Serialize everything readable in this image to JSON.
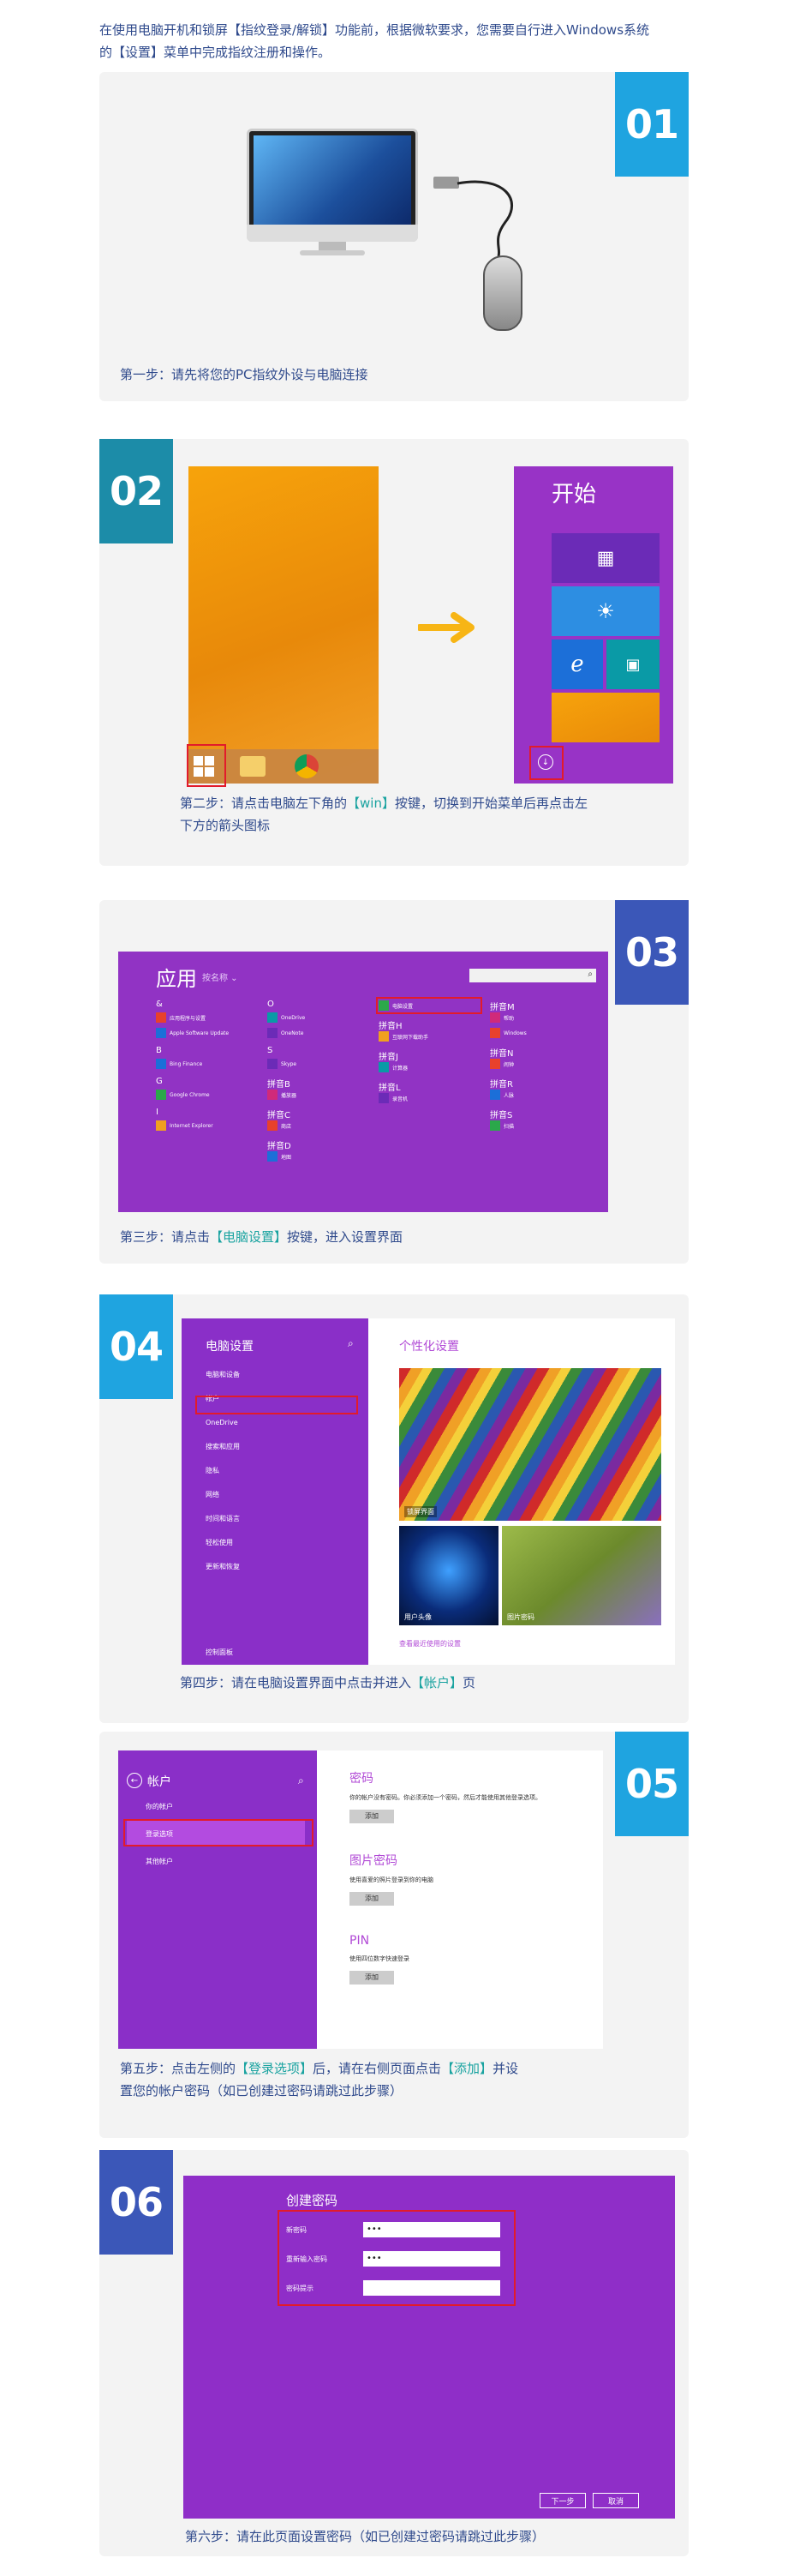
{
  "intro": {
    "line1": "在使用电脑开机和锁屏【指纹登录/解锁】功能前，根据微软要求，您需要自行进入Windows系统",
    "line2": "的【设置】菜单中完成指纹注册和操作。"
  },
  "steps": [
    {
      "badge": "01",
      "caption": "第一步：请先将您的PC指纹外设与电脑连接"
    },
    {
      "badge": "02",
      "caption_pre": "第二步：请点击电脑左下角的",
      "caption_hl": "【win】",
      "caption_post1": "按键，切换到开始菜单后再点击左",
      "caption_post2": "下方的箭头图标"
    },
    {
      "badge": "03",
      "caption_pre": "第三步：请点击",
      "caption_hl": "【电脑设置】",
      "caption_post": "按键，进入设置界面"
    },
    {
      "badge": "04",
      "caption_pre": "第四步：请在电脑设置界面中点击并进入",
      "caption_hl": "【帐户】",
      "caption_post": "页"
    },
    {
      "badge": "05",
      "caption_pre": "第五步：点击左侧的",
      "caption_hl1": "【登录选项】",
      "caption_mid": "后，请在右侧页面点击",
      "caption_hl2": "【添加】",
      "caption_post1": "并设",
      "caption_post2": "置您的帐户密码（如已创建过密码请跳过此步骤）"
    },
    {
      "badge": "06",
      "caption": "第六步：请在此页面设置密码（如已创建过密码请跳过此步骤）"
    }
  ],
  "start_screen": {
    "title": "开始",
    "tiles": [
      "日历",
      "天气",
      "Internet Explorer",
      "照片"
    ]
  },
  "apps_screen": {
    "title": "应用",
    "sort": "按名称 ⌄",
    "groups": [
      {
        "h": "&",
        "items": [
          "应用程序与设置",
          "Apple Software Update"
        ]
      },
      {
        "h": "B",
        "items": [
          "Bing Finance"
        ]
      },
      {
        "h": "G",
        "items": [
          "Google Chrome"
        ]
      },
      {
        "h": "I",
        "items": [
          "Internet Explorer"
        ]
      },
      {
        "h": "O",
        "items": [
          "OneDrive",
          "OneNote"
        ]
      },
      {
        "h": "S",
        "items": [
          "Skype"
        ]
      },
      {
        "h": "拼音B",
        "items": [
          "播放器"
        ]
      },
      {
        "h": "拼音C",
        "items": [
          "商店"
        ]
      },
      {
        "h": "拼音D",
        "items": [
          "地图"
        ]
      },
      {
        "h": "",
        "items": [
          "电脑设置"
        ]
      },
      {
        "h": "拼音H",
        "items": [
          "互联网下载助手"
        ]
      },
      {
        "h": "拼音J",
        "items": [
          "计算器"
        ]
      },
      {
        "h": "拼音L",
        "items": [
          "录音机"
        ]
      },
      {
        "h": "拼音M",
        "items": [
          "帮助",
          "Windows"
        ]
      },
      {
        "h": "拼音N",
        "items": [
          "闹钟"
        ]
      },
      {
        "h": "拼音R",
        "items": [
          "人脉"
        ]
      },
      {
        "h": "拼音S",
        "items": [
          "扫描"
        ]
      }
    ],
    "highlight_item": "电脑设置"
  },
  "pc_settings": {
    "title": "电脑设置",
    "menu": [
      "电脑和设备",
      "帐户",
      "OneDrive",
      "搜索和应用",
      "隐私",
      "网络",
      "时间和语言",
      "轻松使用",
      "更新和恢复"
    ],
    "footer": "控制面板",
    "right_title": "个性化设置",
    "img_labels": [
      "锁屏界面",
      "用户头像",
      "图片密码"
    ],
    "link": "查看最近使用的设置"
  },
  "account": {
    "title": "帐户",
    "menu": [
      "你的帐户",
      "登录选项",
      "其他帐户"
    ],
    "sections": [
      {
        "title": "密码",
        "desc": "你的帐户没有密码。你必须添加一个密码，然后才能使用其他登录选项。",
        "button": "添加"
      },
      {
        "title": "图片密码",
        "desc": "使用喜爱的照片登录到你的电脑",
        "button": "添加"
      },
      {
        "title": "PIN",
        "desc": "使用四位数字快速登录",
        "button": "添加"
      }
    ]
  },
  "create_password": {
    "title": "创建密码",
    "fields": [
      {
        "label": "新密码",
        "value": "•••"
      },
      {
        "label": "重新输入密码",
        "value": "•••"
      },
      {
        "label": "密码提示",
        "value": ""
      }
    ],
    "next": "下一步",
    "cancel": "取消"
  },
  "colors": {
    "badge_cyan": "#1fa4e0",
    "badge_teal": "#1c8ca8",
    "badge_indigo": "#3b57b8",
    "win_purple": "#8b2fc9",
    "highlight_red": "#e21b2b",
    "accent_teal": "#1aa3a0"
  }
}
